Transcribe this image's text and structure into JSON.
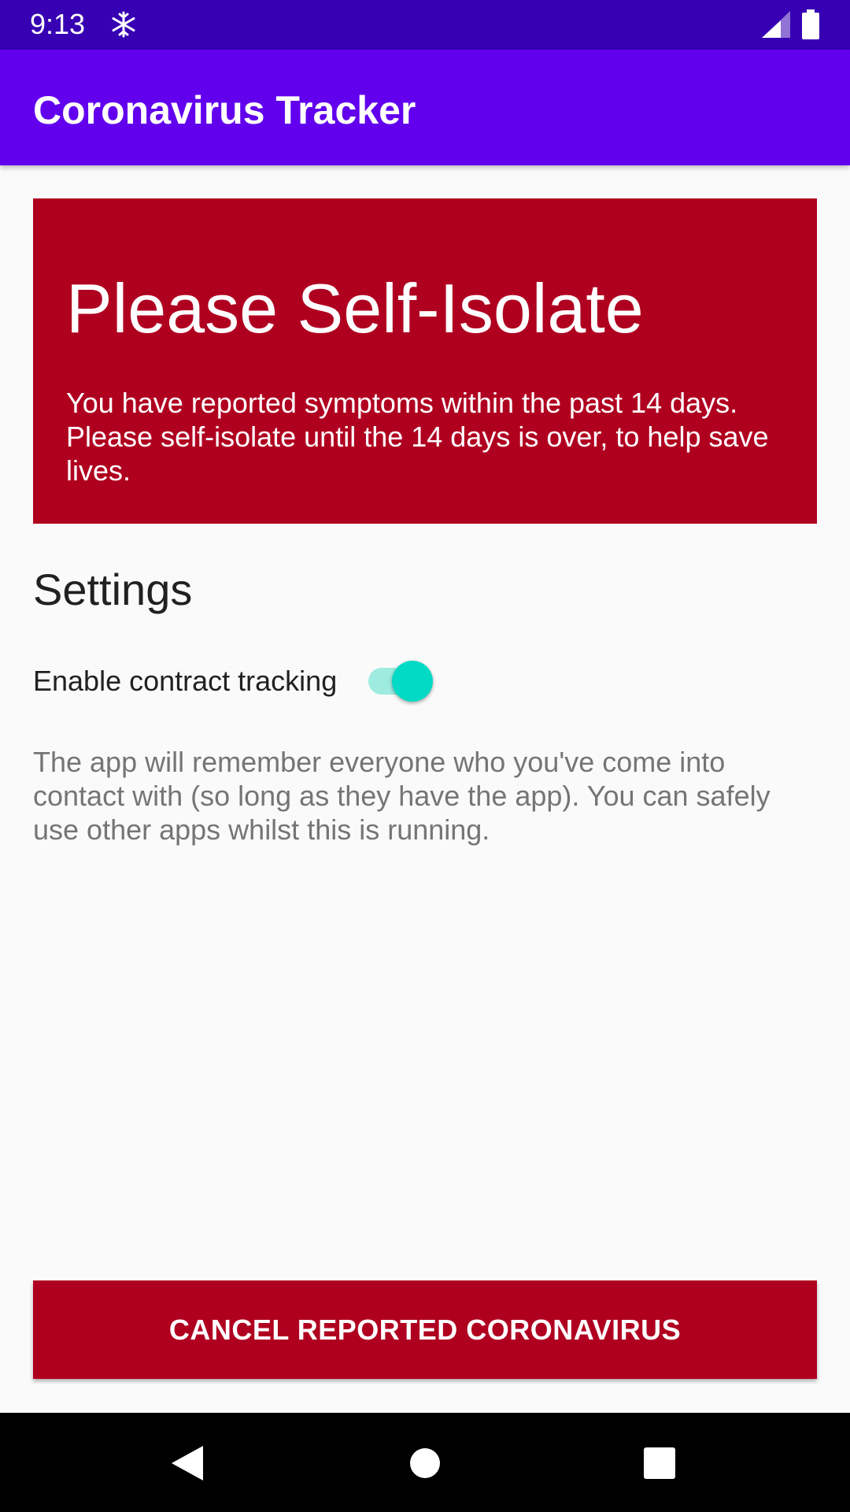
{
  "status_bar": {
    "time": "9:13",
    "icons": [
      "snowflake-icon",
      "signal-icon",
      "battery-icon"
    ]
  },
  "app_bar": {
    "title": "Coronavirus Tracker",
    "color": "#6200EE"
  },
  "alert": {
    "title": "Please Self-Isolate",
    "message": "You have reported symptoms within the past 14 days. Please self-isolate until the 14 days is over, to help save lives.",
    "color": "#B00020"
  },
  "settings": {
    "heading": "Settings",
    "toggle_label": "Enable contract tracking",
    "toggle_on": true,
    "description": "The app will remember everyone who you've come into contact with (so long as they have the app). You can safely use other apps whilst this is running."
  },
  "action": {
    "label": "CANCEL REPORTED CORONAVIRUS"
  },
  "nav_bar": {
    "icons": [
      "back-icon",
      "home-icon",
      "recents-icon"
    ]
  }
}
